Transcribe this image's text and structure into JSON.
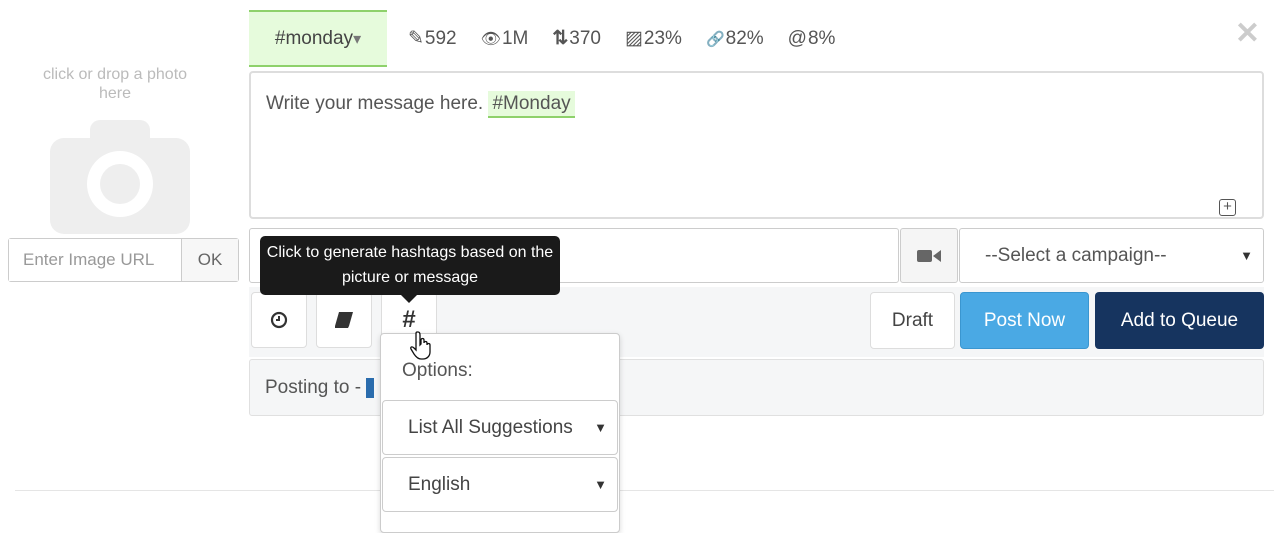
{
  "photo": {
    "drop_text": "click or drop a photo here",
    "url_placeholder": "Enter Image URL",
    "ok_label": "OK"
  },
  "hashtag": {
    "label": "#monday",
    "caret": "▾"
  },
  "stats": [
    {
      "icon": "pencil-icon",
      "glyph": "✎",
      "value": "592"
    },
    {
      "icon": "eye-icon",
      "glyph": "👁",
      "value": "1M"
    },
    {
      "icon": "retweet-icon",
      "glyph": "⇅",
      "value": "370"
    },
    {
      "icon": "image-icon",
      "glyph": "▨",
      "value": "23%"
    },
    {
      "icon": "link-icon",
      "glyph": "🔗",
      "value": "82%"
    },
    {
      "icon": "at-icon",
      "glyph": "@",
      "value": "8%"
    }
  ],
  "close": "✕",
  "message": {
    "text": "Write your message here. ",
    "hashtag": "#Monday"
  },
  "campaign": {
    "selected": "--Select a campaign--"
  },
  "toolbar": {
    "draft": "Draft",
    "post_now": "Post Now",
    "add_to_queue": "Add to Queue",
    "hash_glyph": "#"
  },
  "tooltip": "Click to generate hashtags based on the picture or message",
  "posting": {
    "label": "Posting to - "
  },
  "dropdown": {
    "label": "Options:",
    "suggestion_select": "List All Suggestions",
    "language_select": "English"
  },
  "colors": {
    "accent_green": "#8ed16b",
    "post_now": "#4aa9e4",
    "queue": "#16345f"
  }
}
